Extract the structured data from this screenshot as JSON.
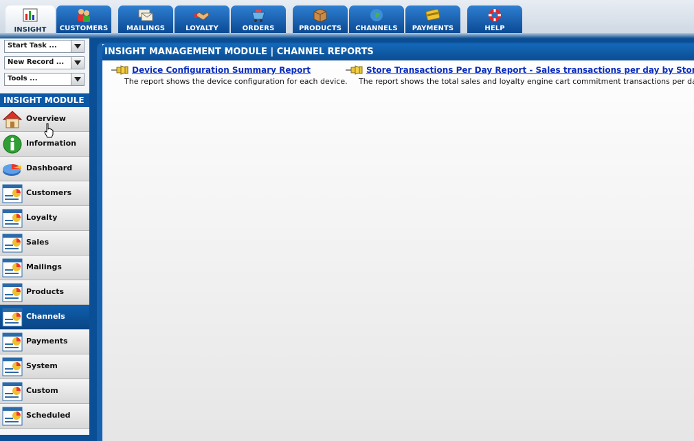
{
  "nav": {
    "tabs": [
      {
        "label": "INSIGHT",
        "icon": "insight-chart-icon",
        "active": true
      },
      {
        "label": "CUSTOMERS",
        "icon": "customers-icon"
      },
      {
        "label": "MAILINGS",
        "icon": "mailings-icon"
      },
      {
        "label": "LOYALTY",
        "icon": "loyalty-handshake-icon"
      },
      {
        "label": "ORDERS",
        "icon": "orders-basket-icon"
      },
      {
        "label": "PRODUCTS",
        "icon": "products-box-icon"
      },
      {
        "label": "CHANNELS",
        "icon": "channels-globe-icon"
      },
      {
        "label": "PAYMENTS",
        "icon": "payments-card-icon"
      },
      {
        "label": "HELP",
        "icon": "help-lifebuoy-icon"
      }
    ]
  },
  "sidebar": {
    "dropdowns": {
      "start_task": "Start Task ...",
      "new_record": "New Record ...",
      "tools": "Tools ..."
    },
    "module_title": "INSIGHT MODULE",
    "items": [
      {
        "label": "Overview",
        "icon": "home-icon"
      },
      {
        "label": "Information",
        "icon": "info-icon"
      },
      {
        "label": "Dashboard",
        "icon": "pie-chart-icon"
      },
      {
        "label": "Customers",
        "icon": "report-icon"
      },
      {
        "label": "Loyalty",
        "icon": "report-icon"
      },
      {
        "label": "Sales",
        "icon": "report-icon"
      },
      {
        "label": "Mailings",
        "icon": "report-icon"
      },
      {
        "label": "Products",
        "icon": "report-icon"
      },
      {
        "label": "Channels",
        "icon": "report-icon",
        "active": true
      },
      {
        "label": "Payments",
        "icon": "report-icon"
      },
      {
        "label": "System",
        "icon": "report-icon"
      },
      {
        "label": "Custom",
        "icon": "report-icon"
      },
      {
        "label": "Scheduled",
        "icon": "report-icon"
      }
    ]
  },
  "main": {
    "title": "INSIGHT MANAGEMENT MODULE | CHANNEL REPORTS",
    "reports": [
      {
        "title": "Device Configuration Summary Report",
        "description": "The report shows the device configuration for each device.",
        "icon": "pushpin-icon"
      },
      {
        "title": "Store Transactions Per Day Report - Sales transactions per day by Store",
        "description": "The report shows the total sales and loyalty engine cart commitment transactions per day.",
        "icon": "pushpin-icon"
      }
    ]
  },
  "colors": {
    "accent": "#0b4e93",
    "link": "#0a2dbd",
    "active_menu": "#0f5fae"
  }
}
